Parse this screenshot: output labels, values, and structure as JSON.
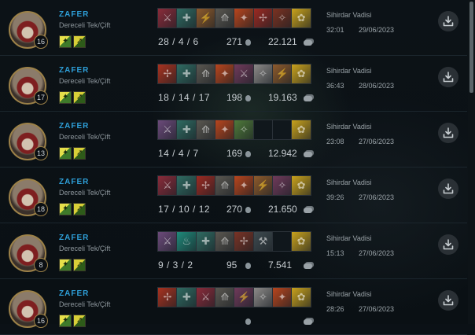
{
  "matches": [
    {
      "level": "16",
      "name": "ZAFER",
      "queue": "Dereceli Tek/Çift",
      "kda": "28 / 4 / 6",
      "cs": "271",
      "gold": "22.121",
      "map": "Sihirdar Vadisi",
      "duration": "32:01",
      "date": "29/06/2023",
      "items": [
        {
          "name": "blade-icon",
          "color": "#8a2b3a",
          "glyph": "⚔"
        },
        {
          "name": "crossbow-icon",
          "color": "#2f6b62",
          "glyph": "✚"
        },
        {
          "name": "shiv-icon",
          "color": "#8d5a2c",
          "glyph": "⚡"
        },
        {
          "name": "boots-icon",
          "color": "#5a5750",
          "glyph": "⟰"
        },
        {
          "name": "sword-icon",
          "color": "#b8451d",
          "glyph": "✦"
        },
        {
          "name": "dagger-icon",
          "color": "#9c2a22",
          "glyph": "✢"
        },
        {
          "name": "bow-icon",
          "color": "#7b3221",
          "glyph": "✧"
        },
        {
          "name": "trinket-icon",
          "color": "#c9a21c",
          "glyph": "✿"
        }
      ]
    },
    {
      "level": "17",
      "name": "ZAFER",
      "queue": "Dereceli Tek/Çift",
      "kda": "18 / 14 / 17",
      "cs": "198",
      "gold": "19.163",
      "map": "Sihirdar Vadisi",
      "duration": "36:43",
      "date": "28/06/2023",
      "items": [
        {
          "name": "dagger-icon",
          "color": "#a8321f",
          "glyph": "✢"
        },
        {
          "name": "crossbow-icon",
          "color": "#2f6b62",
          "glyph": "✚"
        },
        {
          "name": "boots-icon",
          "color": "#5a5750",
          "glyph": "⟰"
        },
        {
          "name": "sword-icon",
          "color": "#b8451d",
          "glyph": "✦"
        },
        {
          "name": "blade-icon",
          "color": "#6f3a5a",
          "glyph": "⚔"
        },
        {
          "name": "wing-icon",
          "color": "#8c8a88",
          "glyph": "✧"
        },
        {
          "name": "shiv-icon",
          "color": "#8d5a2c",
          "glyph": "⚡"
        },
        {
          "name": "trinket-icon",
          "color": "#c9a21c",
          "glyph": "✿"
        }
      ]
    },
    {
      "level": "13",
      "name": "ZAFER",
      "queue": "Dereceli Tek/Çift",
      "kda": "14 / 4 / 7",
      "cs": "169",
      "gold": "12.942",
      "map": "Sihirdar Vadisi",
      "duration": "23:08",
      "date": "27/06/2023",
      "items": [
        {
          "name": "blade-icon",
          "color": "#6b4a7a",
          "glyph": "⚔"
        },
        {
          "name": "crossbow-icon",
          "color": "#2f6b62",
          "glyph": "✚"
        },
        {
          "name": "boots-icon",
          "color": "#5a5750",
          "glyph": "⟰"
        },
        {
          "name": "sword-icon",
          "color": "#b8451d",
          "glyph": "✦"
        },
        {
          "name": "scythe-icon",
          "color": "#4f7a3a",
          "glyph": "✧"
        },
        {
          "name": "empty-slot-icon",
          "color": "#10171c",
          "glyph": ""
        },
        {
          "name": "empty-slot-icon",
          "color": "#10171c",
          "glyph": ""
        },
        {
          "name": "trinket-icon",
          "color": "#c9a21c",
          "glyph": "✿"
        }
      ]
    },
    {
      "level": "18",
      "name": "ZAFER",
      "queue": "Dereceli Tek/Çift",
      "kda": "17 / 10 / 12",
      "cs": "270",
      "gold": "21.650",
      "map": "Sihirdar Vadisi",
      "duration": "39:26",
      "date": "27/06/2023",
      "items": [
        {
          "name": "blade-icon",
          "color": "#8a2b3a",
          "glyph": "⚔"
        },
        {
          "name": "crossbow-icon",
          "color": "#2f6b62",
          "glyph": "✚"
        },
        {
          "name": "dagger-icon",
          "color": "#9c2a22",
          "glyph": "✢"
        },
        {
          "name": "boots-icon",
          "color": "#5a5750",
          "glyph": "⟰"
        },
        {
          "name": "sword-icon",
          "color": "#b8451d",
          "glyph": "✦"
        },
        {
          "name": "shiv-icon",
          "color": "#8d5a2c",
          "glyph": "⚡"
        },
        {
          "name": "bow-icon",
          "color": "#6f3a5a",
          "glyph": "✧"
        },
        {
          "name": "trinket-icon",
          "color": "#c9a21c",
          "glyph": "✿"
        }
      ]
    },
    {
      "level": "8",
      "name": "ZAFER",
      "queue": "Dereceli Tek/Çift",
      "kda": "9 / 3 / 2",
      "cs": "95",
      "gold": "7.541",
      "map": "Sihirdar Vadisi",
      "duration": "15:13",
      "date": "27/06/2023",
      "items": [
        {
          "name": "blade-icon",
          "color": "#6b4a7a",
          "glyph": "⚔"
        },
        {
          "name": "potion-icon",
          "color": "#1f8a7a",
          "glyph": "♨"
        },
        {
          "name": "crossbow-icon",
          "color": "#2f6b62",
          "glyph": "✚"
        },
        {
          "name": "boots-icon",
          "color": "#5a5750",
          "glyph": "⟰"
        },
        {
          "name": "dagger-icon",
          "color": "#7a3325",
          "glyph": "✢"
        },
        {
          "name": "pickaxe-icon",
          "color": "#3e4a4f",
          "glyph": "⚒"
        },
        {
          "name": "empty-slot-icon",
          "color": "#10171c",
          "glyph": ""
        },
        {
          "name": "trinket-icon",
          "color": "#c9a21c",
          "glyph": "✿"
        }
      ]
    },
    {
      "level": "16",
      "name": "ZAFER",
      "queue": "Dereceli Tek/Çift",
      "kda": "",
      "cs": "",
      "gold": "",
      "map": "Sihirdar Vadisi",
      "duration": "28:26",
      "date": "27/06/2023",
      "items": [
        {
          "name": "dagger-icon",
          "color": "#a8321f",
          "glyph": "✢"
        },
        {
          "name": "crossbow-icon",
          "color": "#2f6b62",
          "glyph": "✚"
        },
        {
          "name": "blade-icon",
          "color": "#8a2b3a",
          "glyph": "⚔"
        },
        {
          "name": "boots-icon",
          "color": "#5a5750",
          "glyph": "⟰"
        },
        {
          "name": "shiv-icon",
          "color": "#6f3a5a",
          "glyph": "⚡"
        },
        {
          "name": "wing-icon",
          "color": "#8c8a88",
          "glyph": "✧"
        },
        {
          "name": "sword-icon",
          "color": "#b8451d",
          "glyph": "✦"
        },
        {
          "name": "trinket-icon",
          "color": "#c9a21c",
          "glyph": "✿"
        }
      ]
    }
  ]
}
